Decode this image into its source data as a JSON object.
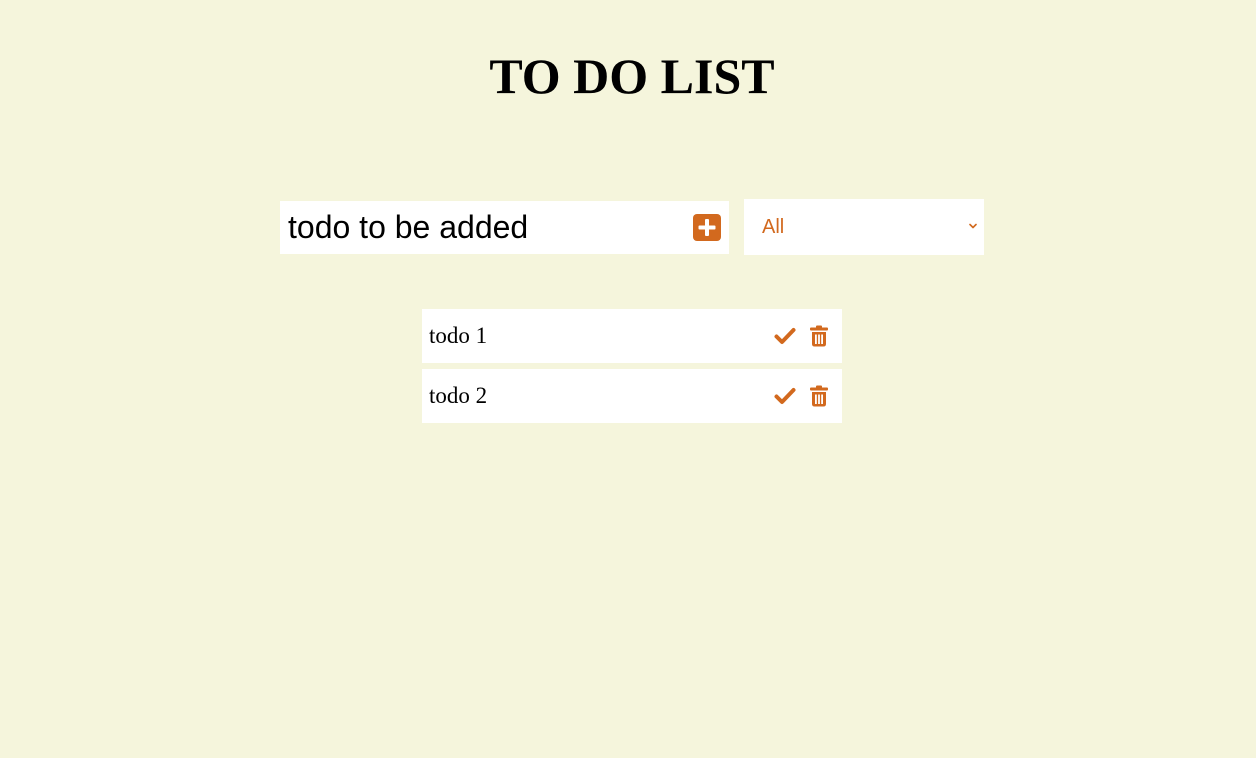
{
  "header": {
    "title": "TO DO LIST"
  },
  "form": {
    "input_value": "todo to be added"
  },
  "filter": {
    "selected": "All"
  },
  "todos": [
    {
      "text": "todo 1"
    },
    {
      "text": "todo 2"
    }
  ],
  "colors": {
    "background": "#f5f5dc",
    "accent": "#d2691e",
    "surface": "#ffffff"
  },
  "icons": {
    "add": "plus-square-icon",
    "complete": "check-icon",
    "delete": "trash-icon",
    "dropdown": "chevron-down-icon"
  }
}
